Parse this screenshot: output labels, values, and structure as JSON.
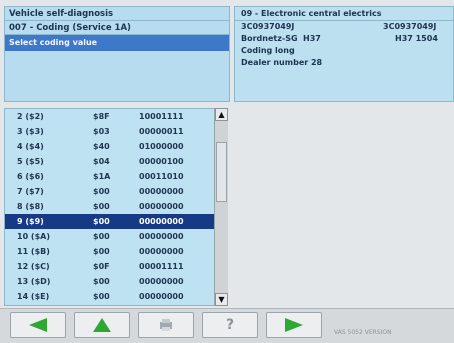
{
  "header_left": {
    "title": "Vehicle self-diagnosis",
    "function": "007 - Coding (Service 1A)",
    "prompt": "Select coding value"
  },
  "header_right": {
    "module": "09 - Electronic central electrics",
    "part_left": "3C0937049J",
    "part_right": "3C0937049J",
    "component": "Bordnetz-SG",
    "component_code": "H37",
    "component_right": "H37 1504",
    "coding_label": "Coding long",
    "dealer_label": "Dealer number 28"
  },
  "coding_list": [
    {
      "index": "2 ($2)",
      "hex": "$8F",
      "bin": "10001111"
    },
    {
      "index": "3 ($3)",
      "hex": "$03",
      "bin": "00000011"
    },
    {
      "index": "4 ($4)",
      "hex": "$40",
      "bin": "01000000"
    },
    {
      "index": "5 ($5)",
      "hex": "$04",
      "bin": "00000100"
    },
    {
      "index": "6 ($6)",
      "hex": "$1A",
      "bin": "00011010"
    },
    {
      "index": "7 ($7)",
      "hex": "$00",
      "bin": "00000000"
    },
    {
      "index": "8 ($8)",
      "hex": "$00",
      "bin": "00000000"
    },
    {
      "index": "9 ($9)",
      "hex": "$00",
      "bin": "00000000",
      "selected": true
    },
    {
      "index": "10 ($A)",
      "hex": "$00",
      "bin": "00000000"
    },
    {
      "index": "11 ($B)",
      "hex": "$00",
      "bin": "00000000"
    },
    {
      "index": "12 ($C)",
      "hex": "$0F",
      "bin": "00001111"
    },
    {
      "index": "13 ($D)",
      "hex": "$00",
      "bin": "00000000"
    },
    {
      "index": "14 ($E)",
      "hex": "$00",
      "bin": "00000000"
    }
  ],
  "toolbar": {
    "back_icon": "arrow-left-icon",
    "up_icon": "arrow-up-icon",
    "print_icon": "print-icon",
    "help_label": "?",
    "next_icon": "arrow-right-icon"
  },
  "status_text": "VAS 5052 VERSION",
  "colors": {
    "panel_blue": "#bfe2f2",
    "selection": "#173a86",
    "prompt_bar": "#3e78c8",
    "arrow_green": "#2fa832"
  }
}
